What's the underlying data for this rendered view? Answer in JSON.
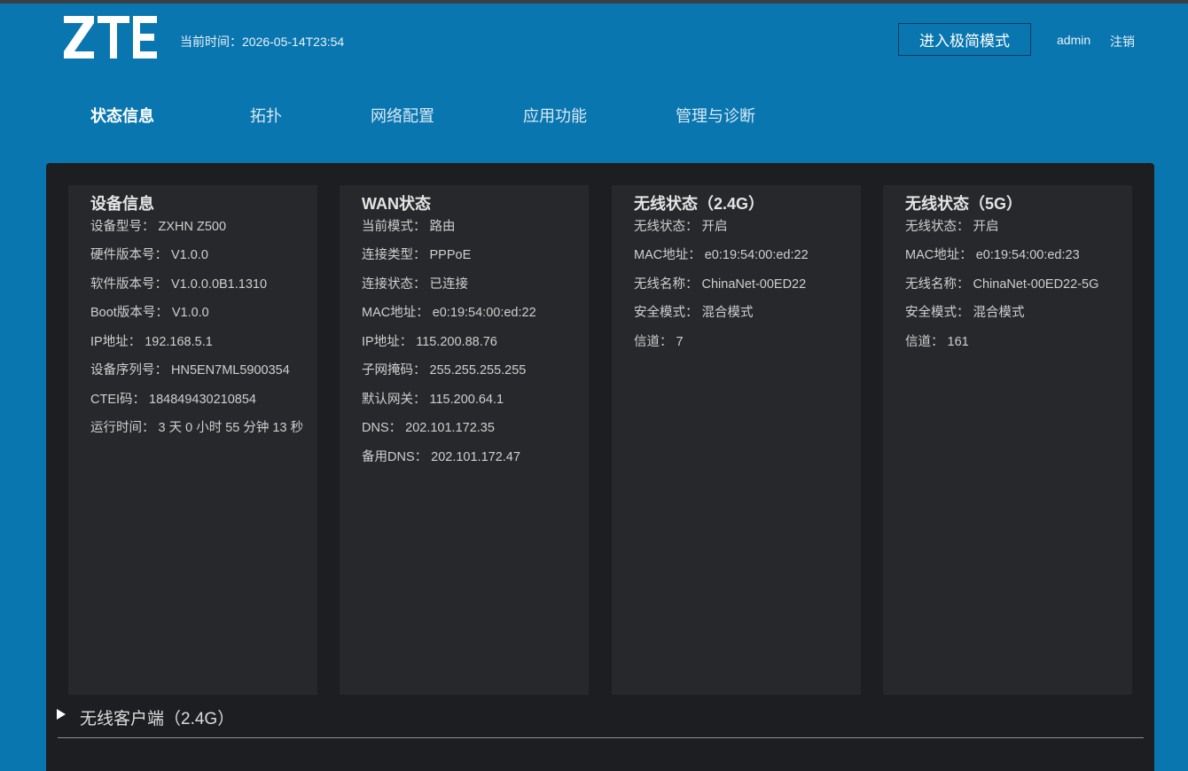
{
  "header": {
    "logo_text": "ZTE",
    "time_label": "当前时间：2026-05-14T23:54",
    "simple_mode_button": "进入极简模式",
    "user": "admin",
    "logout": "注销"
  },
  "nav": {
    "items": [
      "状态信息",
      "拓扑",
      "网络配置",
      "应用功能",
      "管理与诊断"
    ],
    "active_index": 0
  },
  "cards": [
    {
      "title": "设备信息",
      "rows": [
        {
          "label": "设备型号：",
          "value": "ZXHN Z500"
        },
        {
          "label": "硬件版本号：",
          "value": "V1.0.0"
        },
        {
          "label": "软件版本号：",
          "value": "V1.0.0.0B1.1310"
        },
        {
          "label": "Boot版本号：",
          "value": "V1.0.0"
        },
        {
          "label": "IP地址：",
          "value": "192.168.5.1"
        },
        {
          "label": "设备序列号：",
          "value": "HN5EN7ML5900354"
        },
        {
          "label": "CTEI码：",
          "value": "184849430210854"
        },
        {
          "label": "运行时间：",
          "value": "3 天 0 小时 55 分钟 13 秒"
        }
      ]
    },
    {
      "title": "WAN状态",
      "rows": [
        {
          "label": "当前模式：",
          "value": "路由"
        },
        {
          "label": "连接类型：",
          "value": "PPPoE"
        },
        {
          "label": "连接状态：",
          "value": "已连接"
        },
        {
          "label": "MAC地址：",
          "value": "e0:19:54:00:ed:22"
        },
        {
          "label": "IP地址：",
          "value": "115.200.88.76"
        },
        {
          "label": "子网掩码：",
          "value": "255.255.255.255"
        },
        {
          "label": "默认网关：",
          "value": "115.200.64.1"
        },
        {
          "label": "DNS：",
          "value": "202.101.172.35"
        },
        {
          "label": "备用DNS：",
          "value": "202.101.172.47"
        }
      ]
    },
    {
      "title": "无线状态（2.4G）",
      "rows": [
        {
          "label": "无线状态：",
          "value": "开启"
        },
        {
          "label": "MAC地址：",
          "value": "e0:19:54:00:ed:22"
        },
        {
          "label": "无线名称：",
          "value": "ChinaNet-00ED22"
        },
        {
          "label": "安全模式：",
          "value": "混合模式"
        },
        {
          "label": "信道：",
          "value": "7"
        }
      ]
    },
    {
      "title": "无线状态（5G）",
      "rows": [
        {
          "label": "无线状态：",
          "value": "开启"
        },
        {
          "label": "MAC地址：",
          "value": "e0:19:54:00:ed:23"
        },
        {
          "label": "无线名称：",
          "value": "ChinaNet-00ED22-5G"
        },
        {
          "label": "安全模式：",
          "value": "混合模式"
        },
        {
          "label": "信道：",
          "value": "161"
        }
      ]
    }
  ],
  "clients_section": {
    "label": "无线客户端（2.4G）"
  },
  "colors": {
    "header_bg": "#0a76b0",
    "panel_bg": "#1c1e21",
    "card_bg": "#26282b"
  }
}
